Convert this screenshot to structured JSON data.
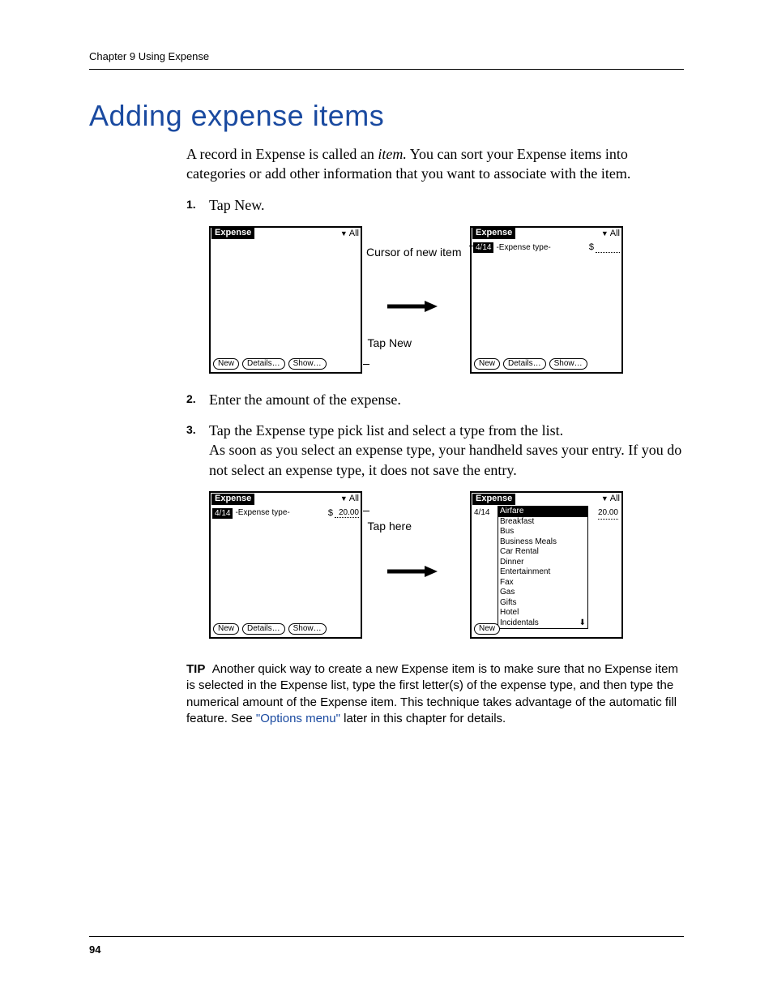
{
  "header": {
    "running": "Chapter 9   Using Expense"
  },
  "title": "Adding expense items",
  "intro_before_em": "A record in Expense is called an ",
  "intro_em": "item.",
  "intro_after_em": " You can sort your Expense items into categories or add other information that you want to associate with the item.",
  "steps": {
    "s1_num": "1.",
    "s1_text": "Tap New.",
    "s2_num": "2.",
    "s2_text": "Enter the amount of the expense.",
    "s3_num": "3.",
    "s3_text": "Tap the Expense type pick list and select a type from the list.",
    "s3_body": "As soon as you select an expense type, your handheld saves your entry. If you do not select an expense type, it does not save the entry."
  },
  "fig1": {
    "pda_title": "Expense",
    "all": "All",
    "cursor_label": "Cursor of new item",
    "tap_new": "Tap New",
    "date": "4/14",
    "type_placeholder": "-Expense type-",
    "currency": "$",
    "btn_new": "New",
    "btn_details": "Details…",
    "btn_show": "Show…"
  },
  "fig2": {
    "tap_here": "Tap here",
    "amount": "20.00",
    "picklist": {
      "selected": "Airfare",
      "opts": [
        "Breakfast",
        "Bus",
        "Business Meals",
        "Car Rental",
        "Dinner",
        "Entertainment",
        "Fax",
        "Gas",
        "Gifts",
        "Hotel",
        "Incidentals"
      ]
    }
  },
  "tip": {
    "label": "TIP",
    "text1": "Another quick way to create a new Expense item is to make sure that no Expense item is selected in the Expense list, type the first letter(s) of the expense type, and then type the numerical amount of the Expense item. This technique takes advantage of the automatic fill feature. See ",
    "link": "\"Options menu\"",
    "text2": " later in this chapter for details."
  },
  "page_number": "94"
}
